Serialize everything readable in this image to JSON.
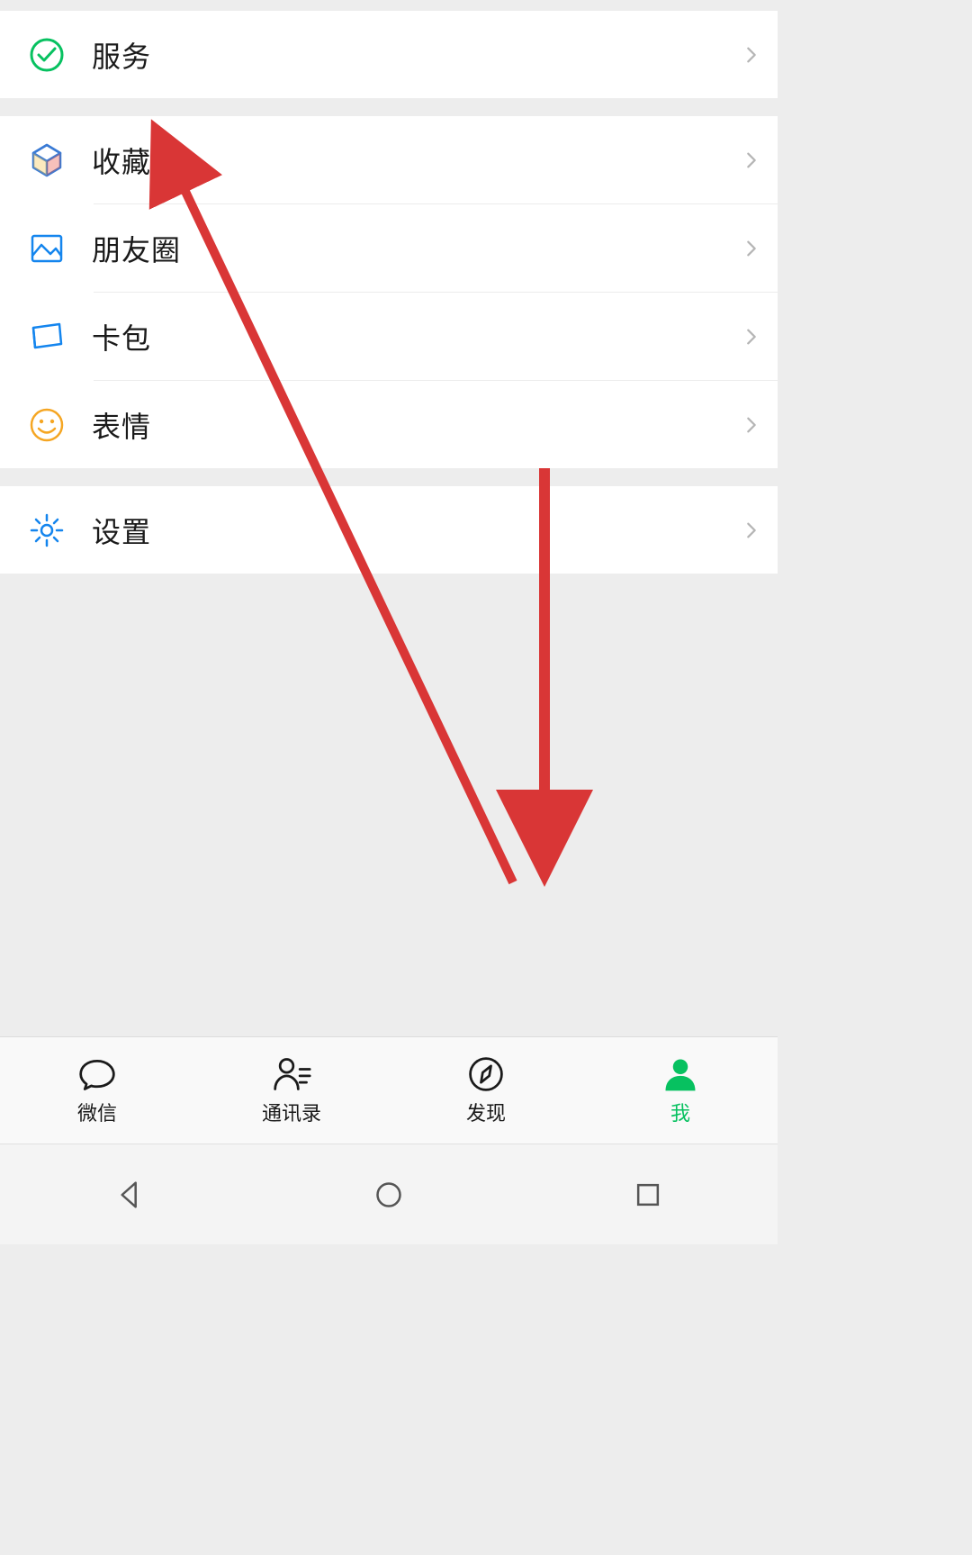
{
  "menu": {
    "services": {
      "label": "服务"
    },
    "favorites": {
      "label": "收藏"
    },
    "moments": {
      "label": "朋友圈"
    },
    "cards": {
      "label": "卡包"
    },
    "stickers": {
      "label": "表情"
    },
    "settings": {
      "label": "设置"
    }
  },
  "tabbar": {
    "wechat": {
      "label": "微信"
    },
    "contacts": {
      "label": "通讯录"
    },
    "discover": {
      "label": "发现"
    },
    "me": {
      "label": "我",
      "active": true
    }
  },
  "colors": {
    "accent": "#07c160",
    "background": "#ededed",
    "card": "#ffffff",
    "annotation": "#d93636"
  }
}
